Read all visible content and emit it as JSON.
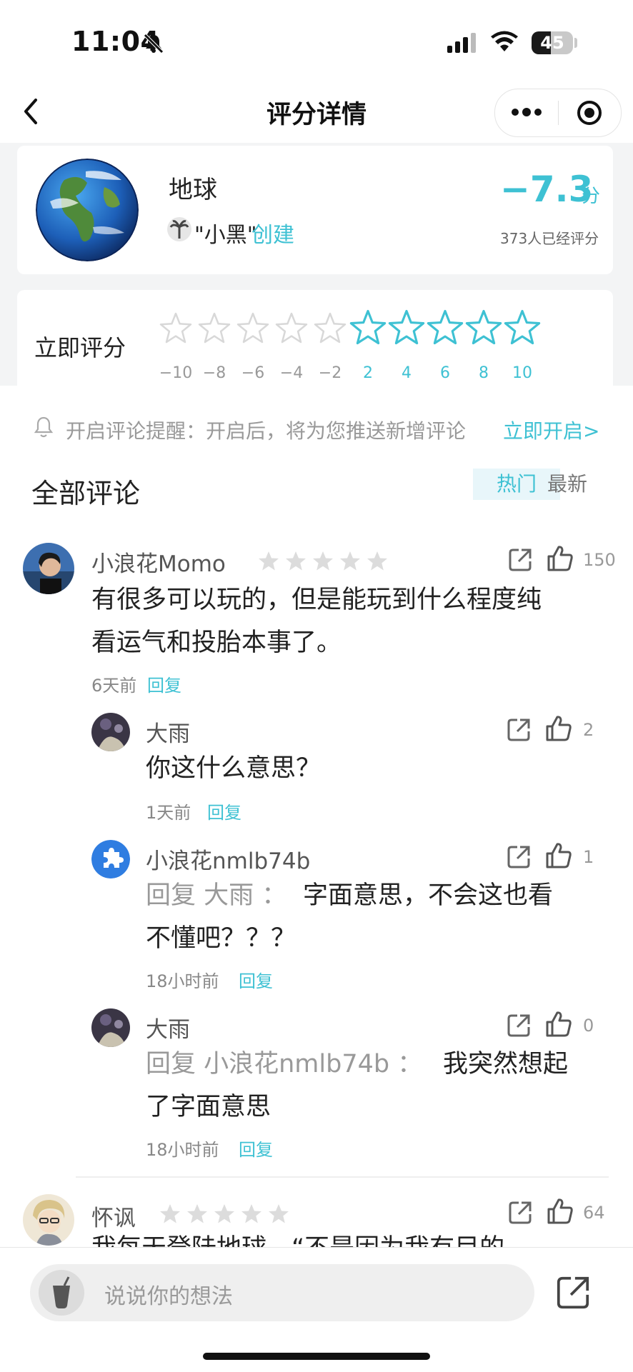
{
  "status_bar": {
    "time": "11:04",
    "battery": "45"
  },
  "nav": {
    "title": "评分详情"
  },
  "planet": {
    "name": "地球",
    "creator_name": "\"小黑\"",
    "creator_suffix": "创建",
    "score": "−7.3",
    "score_unit": "分",
    "rated_count": "373人已经评分"
  },
  "rating": {
    "label": "立即评分",
    "values": [
      "−10",
      "−8",
      "−6",
      "−4",
      "−2",
      "2",
      "4",
      "6",
      "8",
      "10"
    ]
  },
  "notice": {
    "text": "开启评论提醒：开启后，将为您推送新增评论",
    "action": "立即开启>"
  },
  "comments_section": {
    "title": "全部评论",
    "tab_hot": "热门",
    "tab_new": "最新"
  },
  "comments": [
    {
      "user": "小浪花Momo",
      "likes": "150",
      "line1": "有很多可以玩的，但是能玩到什么程度纯",
      "line2": "看运气和投胎本事了。",
      "time": "6天前",
      "reply": "回复"
    },
    {
      "user": "大雨",
      "likes": "2",
      "line1": "你这什么意思？",
      "time": "1天前",
      "reply": "回复"
    },
    {
      "user": "小浪花nmlb74b",
      "likes": "1",
      "reply_prefix": "回复 大雨 ：",
      "line1": "字面意思，不会这也看",
      "line2": "不懂吧？？？",
      "time": "18小时前",
      "reply": "回复"
    },
    {
      "user": "大雨",
      "likes": "0",
      "reply_prefix": "回复 小浪花nmlb74b ：",
      "line1": "我突然想起",
      "line2": "了字面意思",
      "time": "18小时前",
      "reply": "回复"
    },
    {
      "user": "怀讽",
      "likes": "64",
      "line1": "我每天登陆地球，“不是因为我有目的"
    }
  ],
  "input": {
    "placeholder": "说说你的想法"
  },
  "colors": {
    "accent": "#3ec1d3",
    "star_grey": "#d8d8d8"
  }
}
